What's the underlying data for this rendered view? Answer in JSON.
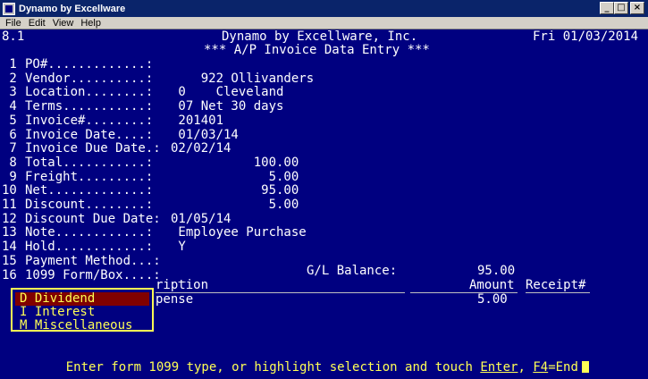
{
  "window": {
    "title": "Dynamo by Excellware",
    "min_label": "_",
    "max_label": "□",
    "close_label": "×"
  },
  "menu": [
    "File",
    "Edit",
    "View",
    "Help"
  ],
  "header": {
    "version": "8.1",
    "company": "Dynamo by Excellware, Inc.",
    "date": "Fri 01/03/2014",
    "subtitle": "*** A/P Invoice Data Entry ***"
  },
  "fields": [
    {
      "num": " 1",
      "label": "PO#.............:",
      "value": ""
    },
    {
      "num": " 2",
      "label": "Vendor..........:",
      "value": "    922 Ollivanders"
    },
    {
      "num": " 3",
      "label": "Location........:",
      "value": " 0    Cleveland"
    },
    {
      "num": " 4",
      "label": "Terms...........:",
      "value": " 07 Net 30 days"
    },
    {
      "num": " 5",
      "label": "Invoice#........:",
      "value": " 201401"
    },
    {
      "num": " 6",
      "label": "Invoice Date....:",
      "value": " 01/03/14"
    },
    {
      "num": " 7",
      "label": "Invoice Due Date.:",
      "value": "02/02/14"
    },
    {
      "num": " 8",
      "label": "Total...........:",
      "value": "           100.00"
    },
    {
      "num": " 9",
      "label": "Freight.........:",
      "value": "             5.00"
    },
    {
      "num": "10",
      "label": "Net.............:",
      "value": "            95.00"
    },
    {
      "num": "11",
      "label": "Discount........:",
      "value": "             5.00"
    },
    {
      "num": "12",
      "label": "Discount Due Date:",
      "value": "01/05/14"
    },
    {
      "num": "13",
      "label": "Note............:",
      "value": " Employee Purchase"
    },
    {
      "num": "14",
      "label": "Hold............:",
      "value": " Y"
    },
    {
      "num": "15",
      "label": "Payment Method...:",
      "value": ""
    },
    {
      "num": "16",
      "label": "1099 Form/Box....:",
      "value": " _"
    }
  ],
  "gl_balance": {
    "label": "G/L Balance:",
    "value": "95.00"
  },
  "detail": {
    "col_description": "ription",
    "col_amount": "Amount",
    "col_receipt": "Receipt#",
    "row_description": "pense",
    "row_amount": "5.00"
  },
  "popup": {
    "options": [
      {
        "text": "D Dividend",
        "selected": true
      },
      {
        "text": "I Interest",
        "selected": false
      },
      {
        "text": "M Miscellaneous",
        "selected": false
      }
    ]
  },
  "status": {
    "prefix": "Enter form 1099 type, or highlight selection and touch ",
    "enter": "Enter",
    "sep": ", ",
    "f4": "F4",
    "suffix": "=End"
  },
  "colors": {
    "background": "#000080",
    "text": "#ffffff",
    "highlight": "#ffff55",
    "selection": "#800000"
  }
}
